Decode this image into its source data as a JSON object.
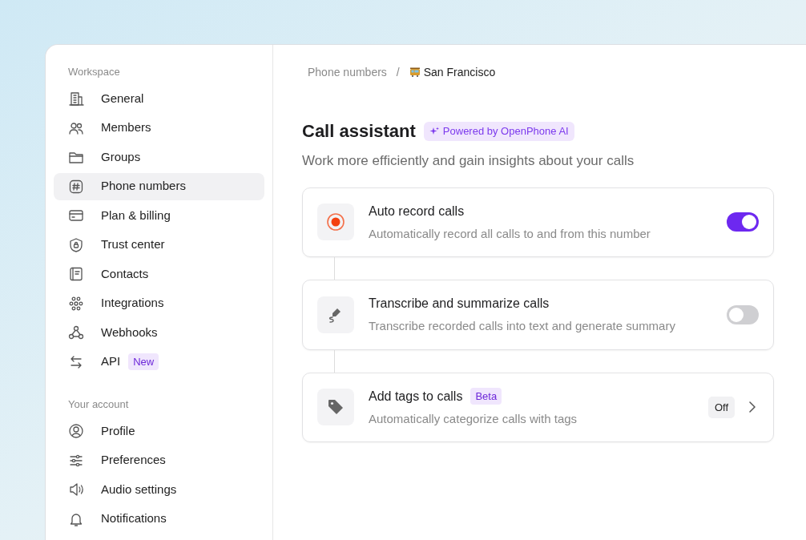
{
  "sidebar": {
    "sections": [
      {
        "title": "Workspace",
        "items": [
          {
            "label": "General",
            "selected": false
          },
          {
            "label": "Members",
            "selected": false
          },
          {
            "label": "Groups",
            "selected": false
          },
          {
            "label": "Phone numbers",
            "selected": true
          },
          {
            "label": "Plan & billing",
            "selected": false
          },
          {
            "label": "Trust center",
            "selected": false
          },
          {
            "label": "Contacts",
            "selected": false
          },
          {
            "label": "Integrations",
            "selected": false
          },
          {
            "label": "Webhooks",
            "selected": false
          },
          {
            "label": "API",
            "selected": false,
            "badge": "New"
          }
        ]
      },
      {
        "title": "Your account",
        "items": [
          {
            "label": "Profile",
            "selected": false
          },
          {
            "label": "Preferences",
            "selected": false
          },
          {
            "label": "Audio settings",
            "selected": false
          },
          {
            "label": "Notifications",
            "selected": false
          }
        ]
      }
    ]
  },
  "breadcrumb": {
    "parent": "Phone numbers",
    "separator": "/",
    "current": "San Francisco"
  },
  "header": {
    "title": "Call assistant",
    "badge": "Powered by OpenPhone AI",
    "subtitle": "Work more efficiently and gain insights about your calls"
  },
  "settings": [
    {
      "kind": "toggle",
      "title": "Auto record calls",
      "description": "Automatically record all calls to and from this number",
      "on": true
    },
    {
      "kind": "toggle",
      "title": "Transcribe and summarize calls",
      "description": "Transcribe recorded calls into text and generate summary",
      "on": false
    },
    {
      "kind": "link",
      "title": "Add tags to calls",
      "badge": "Beta",
      "description": "Automatically categorize calls with tags",
      "status": "Off"
    }
  ]
}
